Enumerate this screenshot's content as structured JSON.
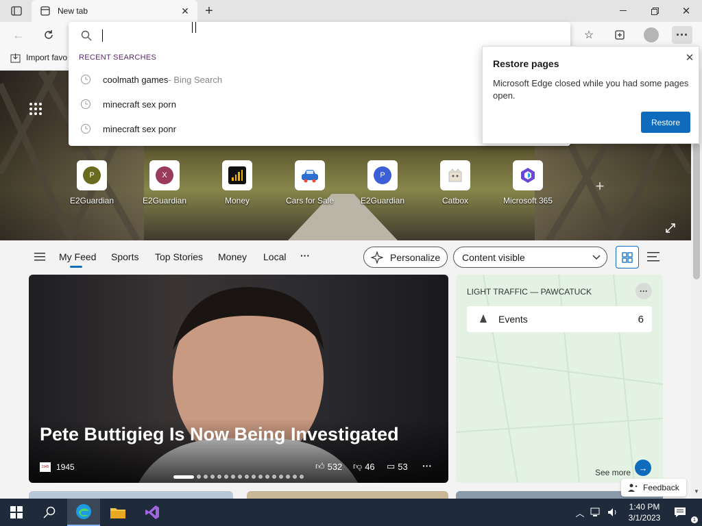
{
  "browser": {
    "tab_title": "New tab",
    "favbar_label": "Import favo",
    "search_value": ""
  },
  "dropdown": {
    "header": "RECENT SEARCHES",
    "items": [
      {
        "text": "coolmath games",
        "suffix": " - Bing Search"
      },
      {
        "text": "minecraft sex porn",
        "suffix": ""
      },
      {
        "text": "minecraft sex ponr",
        "suffix": ""
      }
    ]
  },
  "restore_popup": {
    "title": "Restore pages",
    "body": "Microsoft Edge closed while you had some pages open.",
    "button": "Restore"
  },
  "quick_links": [
    {
      "label": "E2Guardian",
      "letter": "P",
      "color": "#6b6b1f"
    },
    {
      "label": "E2Guardian",
      "letter": "X",
      "color": "#9b3b5c"
    },
    {
      "label": "Money",
      "letter": "",
      "color": "#111111"
    },
    {
      "label": "Cars for Sale",
      "letter": "",
      "color": "#2a6fd1"
    },
    {
      "label": "E2Guardian",
      "letter": "P",
      "color": "#3d5fd6"
    },
    {
      "label": "Catbox",
      "letter": "",
      "color": "#dddddd"
    },
    {
      "label": "Microsoft 365",
      "letter": "",
      "color": "#6a48d7"
    }
  ],
  "feed_nav": {
    "items": [
      "My Feed",
      "Sports",
      "Top Stories",
      "Money",
      "Local"
    ],
    "more": "···",
    "personalize": "Personalize",
    "content_visible": "Content visible"
  },
  "main_story": {
    "headline": "Pete Buttigieg Is Now Being Investigated",
    "source": "1945",
    "source_logo": "1945",
    "likes": "532",
    "dislikes": "46",
    "comments": "53",
    "more": "···"
  },
  "traffic_card": {
    "title": "LIGHT TRAFFIC — PAWCATUCK",
    "events_label": "Events",
    "events_count": "6",
    "see_more": "See more"
  },
  "feedback": "Feedback",
  "taskbar": {
    "time": "1:40 PM",
    "date": "3/1/2023"
  }
}
